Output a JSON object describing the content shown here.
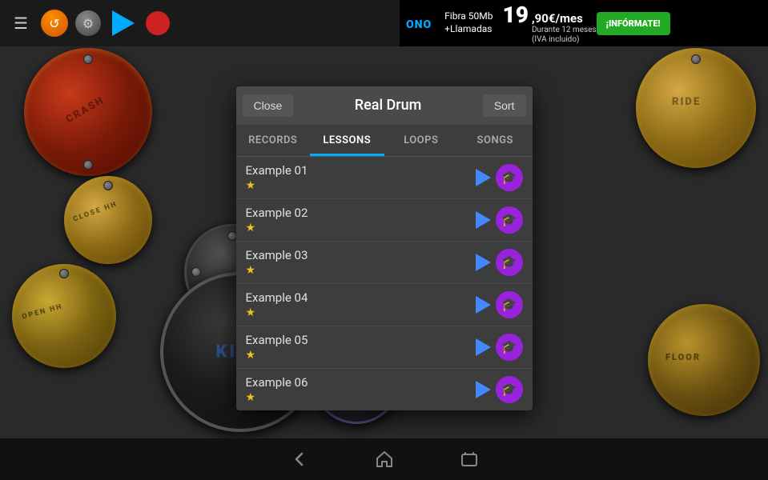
{
  "app": {
    "title": "Real Drum"
  },
  "topbar": {
    "hamburger": "☰",
    "play_label": "play",
    "record_label": "record"
  },
  "ad": {
    "logo": "ONO",
    "line1": "Fibra 50Mb",
    "line2": "+Llamadas",
    "price": "19",
    "price_decimal": ",90€/mes",
    "price_note": "Durante 12 meses",
    "price_note2": "(IVA incluido)",
    "cta": "¡INFÓRMATE!"
  },
  "modal": {
    "close_label": "Close",
    "title": "Real Drum",
    "sort_label": "Sort",
    "tabs": [
      {
        "id": "records",
        "label": "RECORDS",
        "active": false
      },
      {
        "id": "lessons",
        "label": "LESSONS",
        "active": true
      },
      {
        "id": "loops",
        "label": "LOOPS",
        "active": false
      },
      {
        "id": "songs",
        "label": "SONGS",
        "active": false
      }
    ],
    "items": [
      {
        "name": "Example 01",
        "star": "★"
      },
      {
        "name": "Example 02",
        "star": "★"
      },
      {
        "name": "Example 03",
        "star": "★"
      },
      {
        "name": "Example 04",
        "star": "★"
      },
      {
        "name": "Example 05",
        "star": "★"
      },
      {
        "name": "Example 06",
        "star": "★"
      }
    ]
  },
  "bottomnav": {
    "back": "←",
    "home": "⌂",
    "recents": "▭"
  },
  "drums": {
    "crash_label": "CRASH",
    "close_hh_label": "CLOSE HH",
    "open_hh_label": "OPEN HH",
    "ride_label": "RIDE",
    "floor_label": "FLOOR",
    "kick_label": "KICK"
  }
}
